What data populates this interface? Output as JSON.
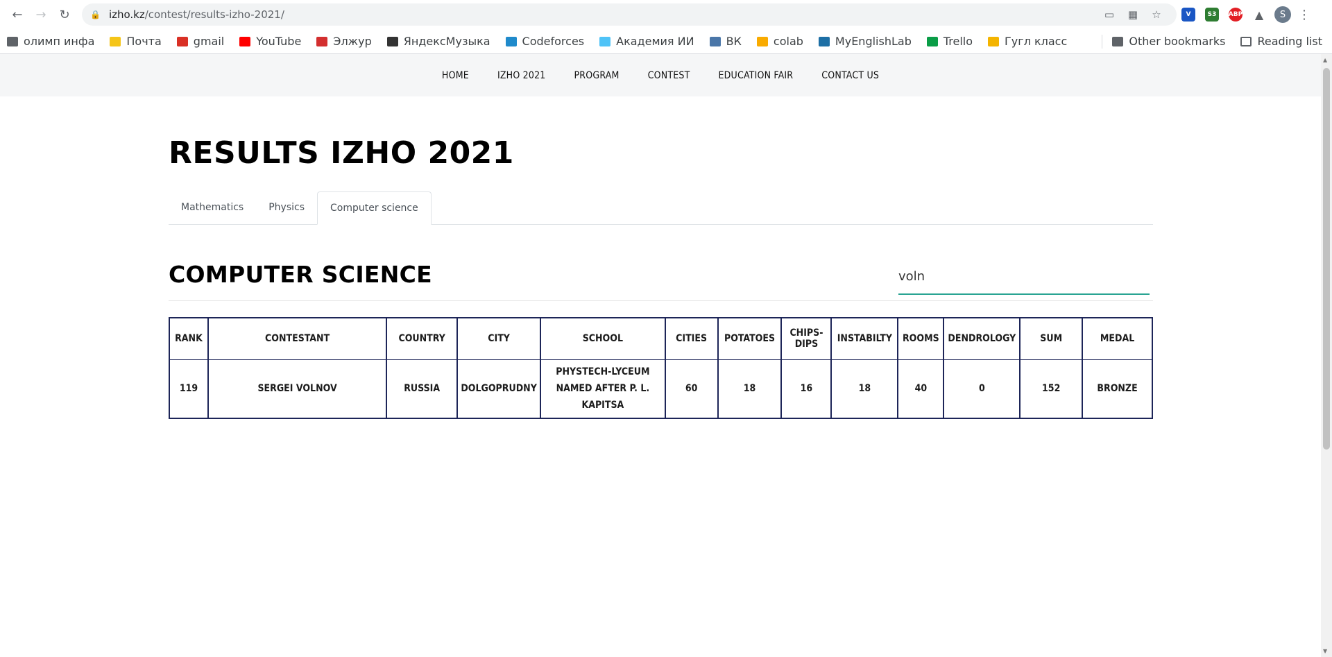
{
  "browser": {
    "url_host": "izho.kz",
    "url_path": "/contest/results-izho-2021/",
    "profile_initial": "S",
    "extensions": [
      {
        "name": "v-extension-icon",
        "label": "",
        "color": "#1a56c4"
      },
      {
        "name": "s3-extension-icon",
        "label": "S3",
        "color": "#2e7d32"
      },
      {
        "name": "adblock-icon",
        "label": "ABP",
        "color": "#e21f25"
      }
    ]
  },
  "bookmarks": {
    "items": [
      {
        "label": "олимп инфа",
        "icon": "folder-icon",
        "color": "#5f6368"
      },
      {
        "label": "Почта",
        "icon": "mail-icon",
        "color": "#f5c518"
      },
      {
        "label": "gmail",
        "icon": "gmail-icon",
        "color": "#d93025"
      },
      {
        "label": "YouTube",
        "icon": "youtube-icon",
        "color": "#ff0000"
      },
      {
        "label": "Элжур",
        "icon": "eljur-icon",
        "color": "#d32f2f"
      },
      {
        "label": "ЯндексМузыка",
        "icon": "yandex-music-icon",
        "color": "#333333"
      },
      {
        "label": "Codeforces",
        "icon": "codeforces-icon",
        "color": "#1f8acb"
      },
      {
        "label": "Академия ИИ",
        "icon": "ai-academy-icon",
        "color": "#4fc3f7"
      },
      {
        "label": "ВК",
        "icon": "vk-icon",
        "color": "#4a76a8"
      },
      {
        "label": "colab",
        "icon": "colab-icon",
        "color": "#f9ab00"
      },
      {
        "label": "MyEnglishLab",
        "icon": "myenglishlab-icon",
        "color": "#1d6fa5"
      },
      {
        "label": "Trello",
        "icon": "trello-icon",
        "color": "#0a9d47"
      },
      {
        "label": "Гугл класс",
        "icon": "google-classroom-icon",
        "color": "#f4b400"
      }
    ],
    "other": "Other bookmarks",
    "reading_list": "Reading list"
  },
  "site_nav": [
    "HOME",
    "IZHO 2021",
    "PROGRAM",
    "CONTEST",
    "EDUCATION FAIR",
    "CONTACT US"
  ],
  "page_title": "RESULTS IZHO 2021",
  "tabs": [
    {
      "label": "Mathematics",
      "active": false
    },
    {
      "label": "Physics",
      "active": false
    },
    {
      "label": "Computer science",
      "active": true
    }
  ],
  "section_title": "COMPUTER SCIENCE",
  "search_value": "voln",
  "table": {
    "headers": [
      "RANK",
      "CONTESTANT",
      "COUNTRY",
      "CITY",
      "SCHOOL",
      "CITIES",
      "POTATOES",
      "CHIPS-DIPS",
      "INSTABILTY",
      "ROOMS",
      "DENDROLOGY",
      "SUM",
      "MEDAL"
    ],
    "rows": [
      [
        "119",
        "SERGEI VOLNOV",
        "RUSSIA",
        "DOLGOPRUDNY",
        "PHYSTECH-LYCEUM NAMED AFTER P. L. KAPITSA",
        "60",
        "18",
        "16",
        "18",
        "40",
        "0",
        "152",
        "BRONZE"
      ]
    ]
  }
}
